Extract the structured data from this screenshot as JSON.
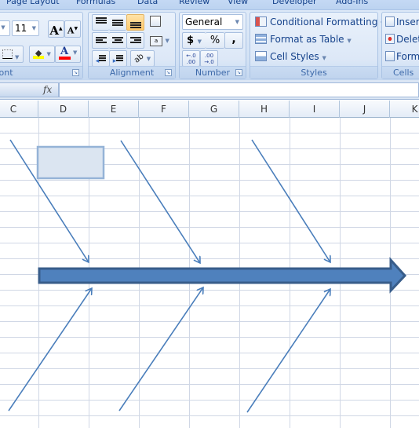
{
  "ribbon": {
    "tabs": [
      "Page Layout",
      "Formulas",
      "Data",
      "Review",
      "View",
      "Developer",
      "Add-Ins"
    ],
    "font_group": {
      "label": "Font",
      "font_size": "11",
      "grow_font": "A",
      "shrink_font": "A",
      "font_color_letter": "A",
      "fill_color": "#ffff00",
      "font_color": "#ff0000"
    },
    "alignment_group": {
      "label": "Alignment"
    },
    "number_group": {
      "label": "Number",
      "format": "General",
      "currency": "$",
      "percent": "%",
      "comma": ",",
      "increase_decimal": "←.0 .00",
      "decrease_decimal": ".00 →.0"
    },
    "styles_group": {
      "label": "Styles",
      "conditional_formatting": "Conditional Formatting",
      "format_as_table": "Format as Table",
      "cell_styles": "Cell Styles"
    },
    "cells_group": {
      "label": "Cells",
      "insert": "Insert",
      "delete": "Delete",
      "format": "Format"
    }
  },
  "formula_bar": {
    "fx_label": "fx",
    "value": ""
  },
  "columns": [
    "C",
    "D",
    "E",
    "F",
    "G",
    "H",
    "I",
    "J",
    "K"
  ],
  "diagram": {
    "type": "fishbone",
    "spine_color": "#4f81bd",
    "spine_border": "#385d8a",
    "bone_color": "#4a7ebb",
    "text_box_fill": "#dbe5f1",
    "text_box_border": "#95b3d7",
    "text_box_text": ""
  }
}
